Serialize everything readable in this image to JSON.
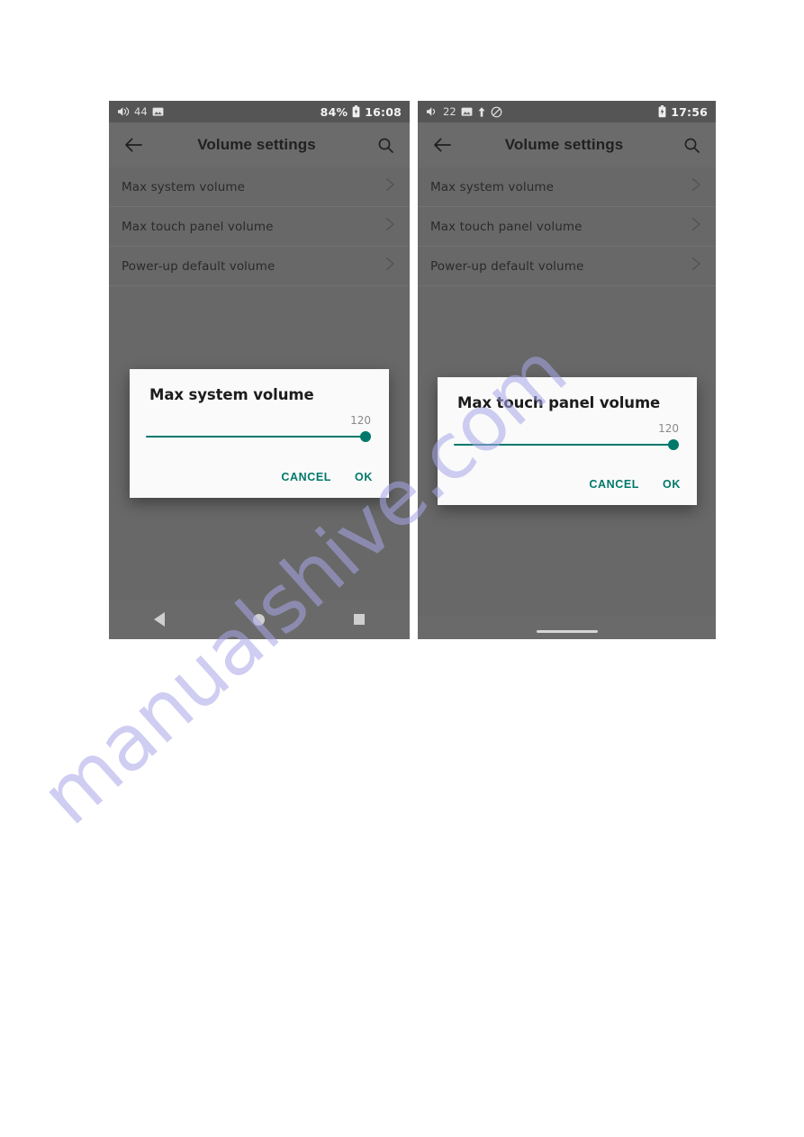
{
  "page": {
    "background_color": "#ffffff",
    "watermark_text": "manualshive.com",
    "watermark_color": "#a8a6e8"
  },
  "theme": {
    "accent_color": "#00796b",
    "phone_background": "#6b6b6b",
    "status_bar_background": "#555555",
    "dialog_background": "#fafafa",
    "nav_bar_background": "#6a6a6a"
  },
  "screens": [
    {
      "id": "left",
      "status_bar": {
        "volume_icon": "speaker-icon",
        "volume_value": "44",
        "image_icon": "image-icon",
        "battery_percent": "84%",
        "battery_icon": "battery-icon",
        "clock": "16:08"
      },
      "app_bar": {
        "back_icon": "back-arrow-icon",
        "title": "Volume settings",
        "search_icon": "search-icon"
      },
      "list": [
        {
          "label": "Max system volume",
          "chevron": "chevron-right-icon"
        },
        {
          "label": "Max touch panel volume",
          "chevron": "chevron-right-icon"
        },
        {
          "label": "Power-up default volume",
          "chevron": "chevron-right-icon"
        }
      ],
      "dialog": {
        "title": "Max system volume",
        "slider_value": "120",
        "slider_percent": 100,
        "cancel_label": "CANCEL",
        "ok_label": "OK"
      },
      "nav_bar": {
        "type": "three-button",
        "back_icon": "nav-back-triangle-icon",
        "home_icon": "nav-home-circle-icon",
        "recents_icon": "nav-recents-square-icon"
      }
    },
    {
      "id": "right",
      "status_bar": {
        "volume_icon": "speaker-icon",
        "volume_value": "22",
        "image_icon": "image-icon",
        "upload_icon": "upload-arrow-icon",
        "dnd_icon": "do-not-disturb-icon",
        "battery_percent": "",
        "battery_icon": "battery-icon",
        "clock": "17:56"
      },
      "app_bar": {
        "back_icon": "back-arrow-icon",
        "title": "Volume settings",
        "search_icon": "search-icon"
      },
      "list": [
        {
          "label": "Max system volume",
          "chevron": "chevron-right-icon"
        },
        {
          "label": "Max touch panel volume",
          "chevron": "chevron-right-icon"
        },
        {
          "label": "Power-up default volume",
          "chevron": "chevron-right-icon"
        }
      ],
      "dialog": {
        "title": "Max touch panel volume",
        "slider_value": "120",
        "slider_percent": 100,
        "cancel_label": "CANCEL",
        "ok_label": "OK"
      },
      "nav_bar": {
        "type": "gesture",
        "handle_icon": "gesture-handle-icon"
      }
    }
  ]
}
